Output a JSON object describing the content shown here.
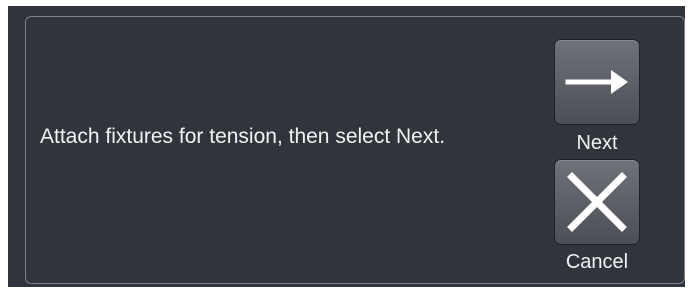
{
  "dialog": {
    "message": "Attach fixtures for tension, then select Next.",
    "next_label": "Next",
    "cancel_label": "Cancel"
  },
  "icons": {
    "next": "right-arrow-icon",
    "cancel": "close-x-icon"
  },
  "colors": {
    "background": "#2f333a",
    "text": "#f1f2f4",
    "button": "#5b5f65"
  }
}
